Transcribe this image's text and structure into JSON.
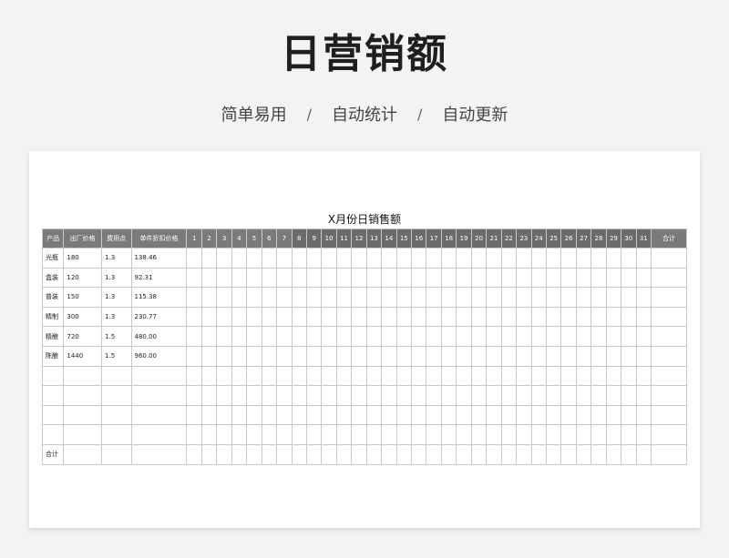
{
  "hero": {
    "title": "日营销额",
    "taglines": [
      "简单易用",
      "自动统计",
      "自动更新"
    ],
    "separator": "/"
  },
  "sheet": {
    "title": "X月份日销售额",
    "headers": {
      "product": "产品",
      "factory_price": "出厂价格",
      "cost_point": "费用点",
      "unit_discount_price": "单件折扣价格",
      "days": [
        "1",
        "2",
        "3",
        "4",
        "5",
        "6",
        "7",
        "8",
        "9",
        "10",
        "11",
        "12",
        "13",
        "14",
        "15",
        "16",
        "17",
        "18",
        "19",
        "20",
        "21",
        "22",
        "23",
        "24",
        "25",
        "26",
        "27",
        "28",
        "29",
        "30",
        "31"
      ],
      "total": "合计"
    },
    "rows": [
      {
        "product": "光瓶",
        "factory_price": "180",
        "cost_point": "1.3",
        "unit_discount_price": "138.46"
      },
      {
        "product": "盒装",
        "factory_price": "120",
        "cost_point": "1.3",
        "unit_discount_price": "92.31"
      },
      {
        "product": "普装",
        "factory_price": "150",
        "cost_point": "1.3",
        "unit_discount_price": "115.38"
      },
      {
        "product": "精制",
        "factory_price": "300",
        "cost_point": "1.3",
        "unit_discount_price": "230.77"
      },
      {
        "product": "精酿",
        "factory_price": "720",
        "cost_point": "1.5",
        "unit_discount_price": "480.00"
      },
      {
        "product": "陈酿",
        "factory_price": "1440",
        "cost_point": "1.5",
        "unit_discount_price": "960.00"
      },
      {
        "product": "",
        "factory_price": "",
        "cost_point": "",
        "unit_discount_price": ""
      },
      {
        "product": "",
        "factory_price": "",
        "cost_point": "",
        "unit_discount_price": ""
      },
      {
        "product": "",
        "factory_price": "",
        "cost_point": "",
        "unit_discount_price": ""
      },
      {
        "product": "",
        "factory_price": "",
        "cost_point": "",
        "unit_discount_price": ""
      }
    ],
    "footer_label": "合计",
    "colors": {
      "header_bg": "#7a7a7a",
      "header_text": "#ffffff",
      "border": "#c8c8c8"
    }
  }
}
